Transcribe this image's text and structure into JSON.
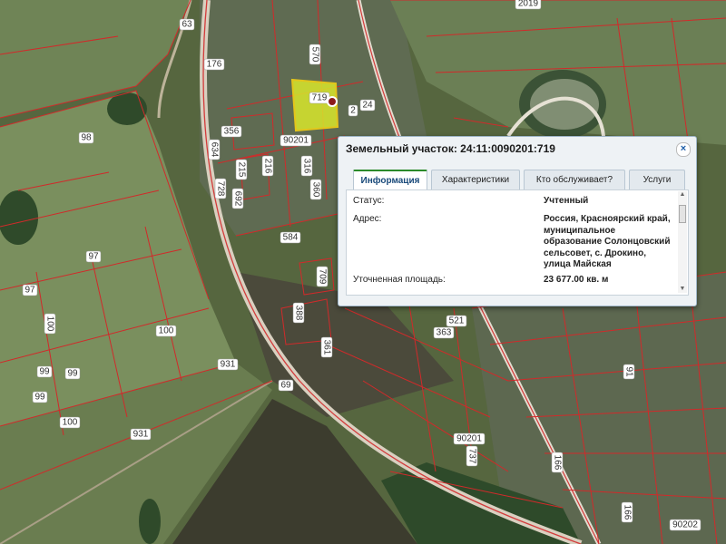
{
  "map": {
    "parcel_numbers": [
      "63",
      "176",
      "570",
      "719",
      "24",
      "2",
      "356",
      "90201",
      "634",
      "215",
      "216",
      "728",
      "692",
      "316",
      "360",
      "584",
      "98",
      "97",
      "97",
      "100",
      "100",
      "99",
      "99",
      "99",
      "100",
      "931",
      "931",
      "709",
      "388",
      "361",
      "521",
      "363",
      "69",
      "737",
      "90201",
      "91",
      "166",
      "166",
      "90202",
      "2019"
    ],
    "selected_parcel": "719"
  },
  "popup": {
    "title": "Земельный участок: 24:11:0090201:719",
    "close_glyph": "×",
    "tabs": [
      "Информация",
      "Характеристики",
      "Кто обслуживает?",
      "Услуги"
    ],
    "rows": [
      {
        "label": "Статус:",
        "value": "Учтенный"
      },
      {
        "label": "Адрес:",
        "value": "Россия, Красноярский край, муниципальное образование Солонцовский сельсовет, с. Дрокино, улица Майская"
      },
      {
        "label": "Уточненная площадь:",
        "value": "23 677.00 кв. м"
      }
    ]
  }
}
